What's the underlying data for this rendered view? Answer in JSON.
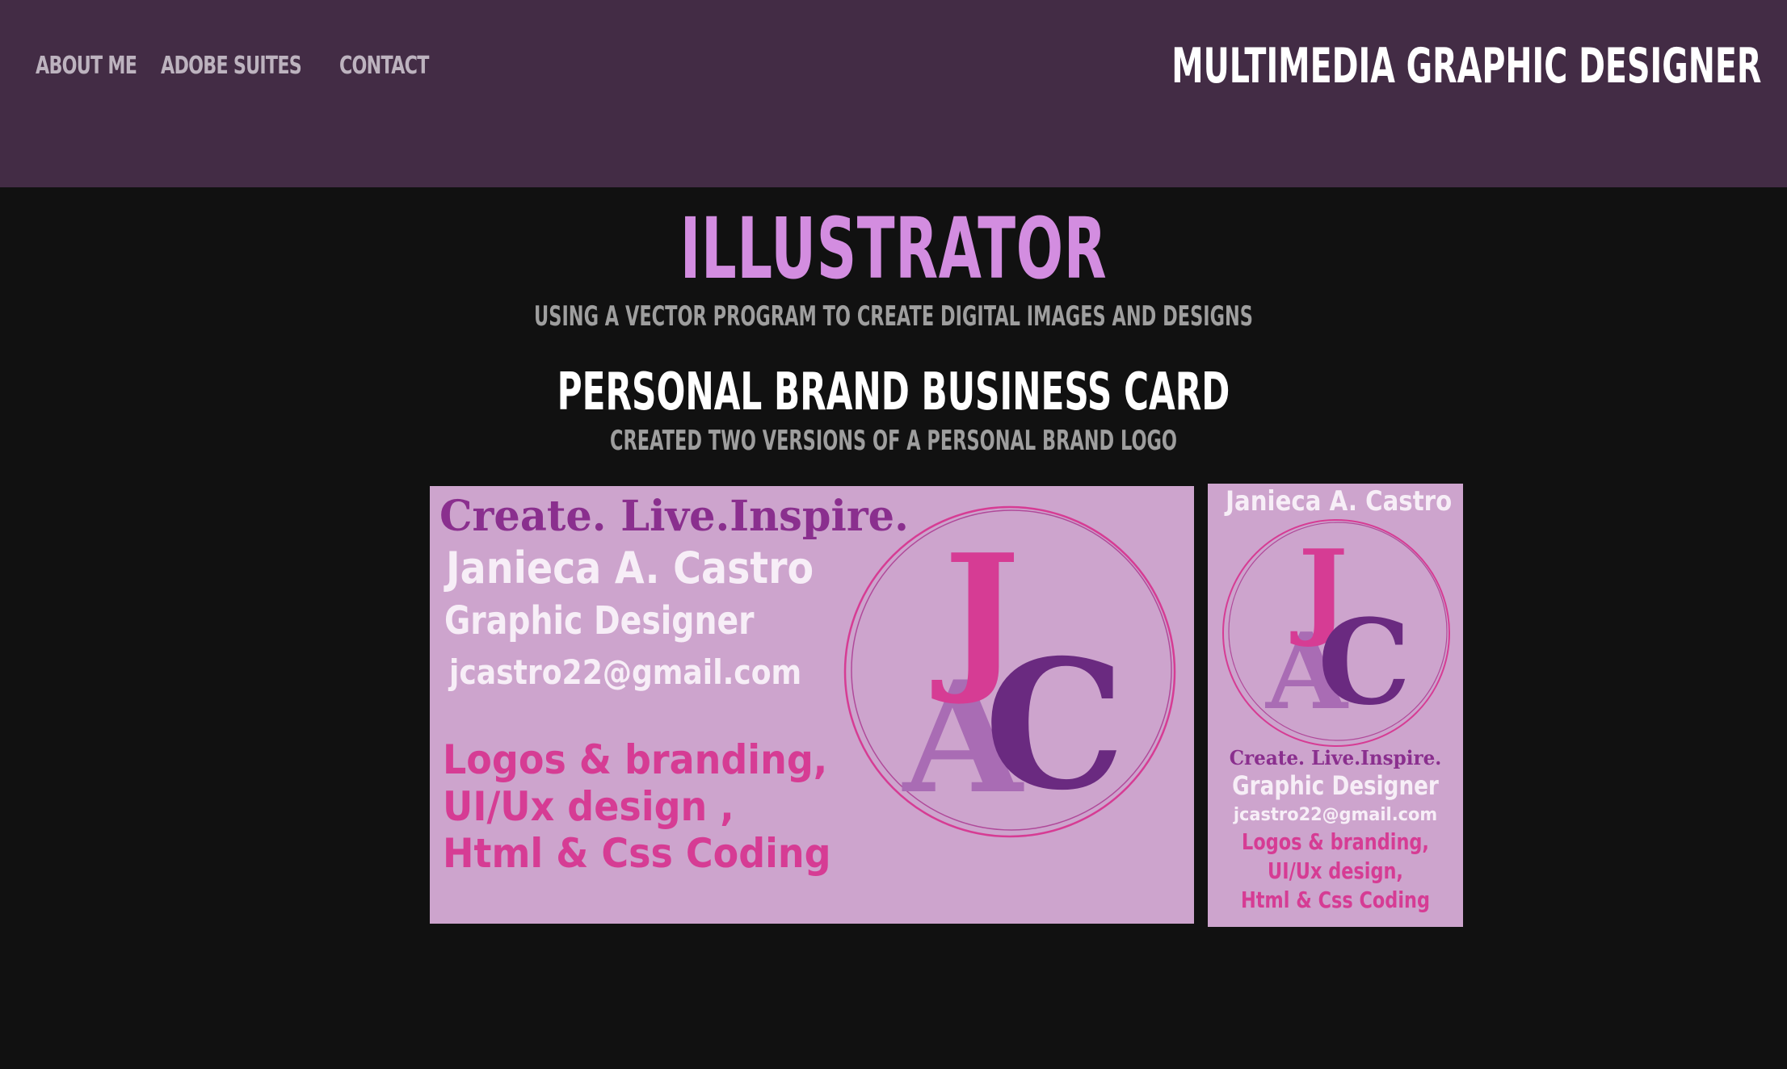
{
  "header": {
    "nav": [
      {
        "label": "ABOUT ME"
      },
      {
        "label": "ADOBE SUITES"
      },
      {
        "label": "CONTACT"
      }
    ],
    "site_title": "MULTIMEDIA GRAPHIC DESIGNER"
  },
  "main": {
    "section_title": "ILLUSTRATOR",
    "section_subtitle": "USING A VECTOR PROGRAM TO CREATE DIGITAL IMAGES AND DESIGNS",
    "project_title": "PERSONAL BRAND BUSINESS CARD",
    "project_subtitle": "CREATED TWO VERSIONS OF A PERSONAL BRAND LOGO"
  },
  "card_horizontal": {
    "tagline": "Create. Live.Inspire.",
    "name": "Janieca A. Castro",
    "role": "Graphic Designer",
    "email": "jcastro22@gmail.com",
    "skills": [
      "Logos & branding,",
      "UI/Ux design ,",
      "Html & Css Coding"
    ],
    "logo_letters": {
      "j": "J",
      "a": "A",
      "c": "C"
    }
  },
  "card_vertical": {
    "name": "Janieca A. Castro",
    "tagline": "Create. Live.Inspire.",
    "role": "Graphic Designer",
    "email": "jcastro22@gmail.com",
    "skills": [
      "Logos & branding,",
      "UI/Ux design,",
      "Html & Css Coding"
    ],
    "logo_letters": {
      "j": "J",
      "a": "A",
      "c": "C"
    }
  },
  "colors": {
    "header_bg": "#432c45",
    "page_bg": "#111111",
    "accent_title": "#d38de0",
    "card_bg": "#cda4cd",
    "logo_pink": "#d63c94",
    "logo_purple": "#6a2a80",
    "logo_lavender": "#a96cb4"
  }
}
